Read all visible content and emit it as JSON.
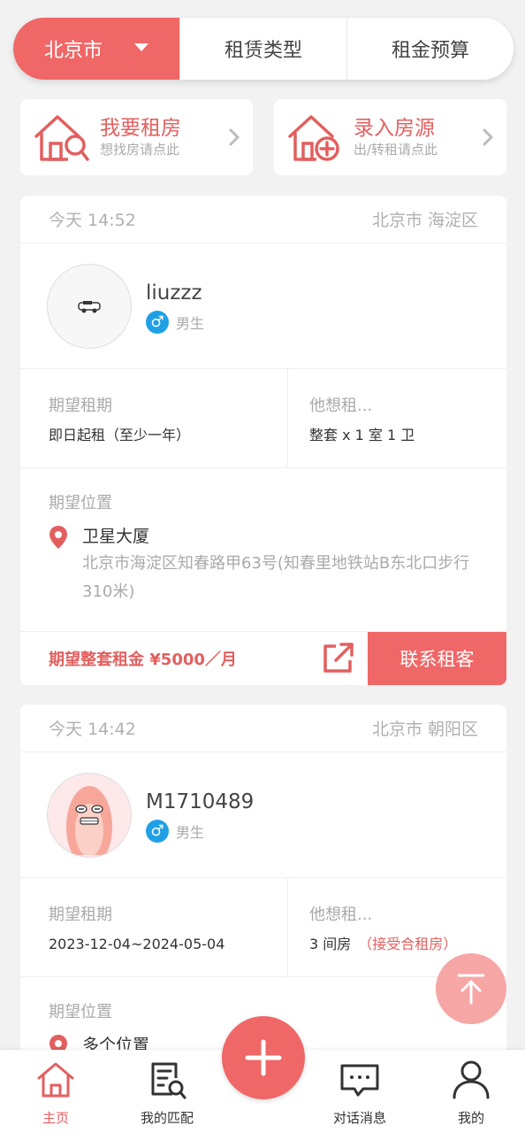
{
  "filters": {
    "city": "北京市",
    "type": "租赁类型",
    "budget": "租金预算"
  },
  "quick": {
    "rent": {
      "title": "我要租房",
      "sub": "想找房请点此"
    },
    "list": {
      "title": "录入房源",
      "sub": "出/转租请点此"
    }
  },
  "listings": [
    {
      "time": "今天 14:52",
      "area": "北京市 海淀区",
      "username": "liuzzz",
      "gender": "男生",
      "period_label": "期望租期",
      "period": "即日起租（至少一年）",
      "want_label": "他想租...",
      "want": "整套 x 1 室 1 卫",
      "want_extra": "",
      "loc_label": "期望位置",
      "loc_name": "卫星大厦",
      "loc_addr": "北京市海淀区知春路甲63号(知春里地铁站B东北口步行310米)",
      "price": "期望整套租金 ¥5000／月",
      "contact": "联系租客"
    },
    {
      "time": "今天 14:42",
      "area": "北京市 朝阳区",
      "username": "M1710489",
      "gender": "男生",
      "period_label": "期望租期",
      "period": "2023-12-04~2024-05-04",
      "want_label": "他想租...",
      "want": "3 间房",
      "want_extra": "（接受合租房）",
      "loc_label": "期望位置",
      "loc_name": "多个位置"
    }
  ],
  "nav": {
    "home": "主页",
    "match": "我的匹配",
    "messages": "对话消息",
    "mine": "我的"
  },
  "colors": {
    "accent": "#f06767",
    "gender_male": "#1fa0e6",
    "background": "#f2f2f2"
  }
}
